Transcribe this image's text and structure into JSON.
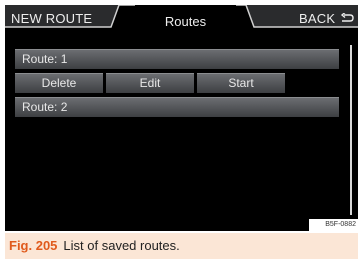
{
  "header": {
    "left_tab": "NEW ROUTE",
    "title": "Routes",
    "right_tab": "BACK"
  },
  "routes": [
    {
      "label": "Route: 1"
    },
    {
      "label": "Route: 2"
    }
  ],
  "actions": {
    "delete": "Delete",
    "edit": "Edit",
    "start": "Start"
  },
  "figure": {
    "code": "B5F-0882",
    "label": "Fig. 205",
    "caption": "List of saved routes."
  },
  "colors": {
    "screen_bg": "#000000",
    "button_face": "#55575a",
    "caption_bg": "#fbe6d6",
    "caption_accent": "#e05a1c"
  }
}
